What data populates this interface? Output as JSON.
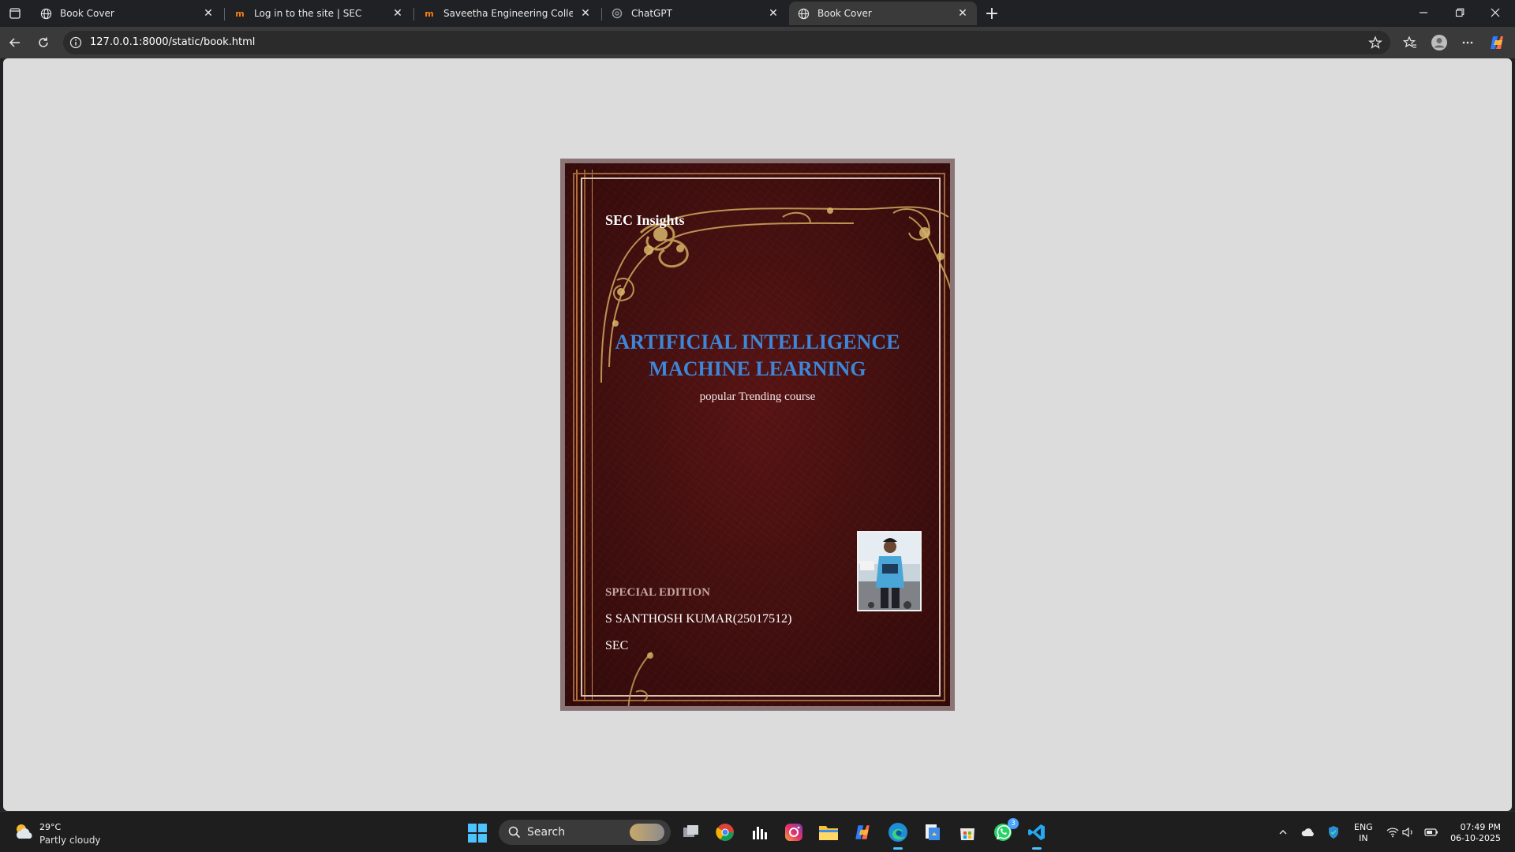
{
  "browser": {
    "tabs": [
      {
        "title": "Book Cover",
        "icon": "globe-icon"
      },
      {
        "title": "Log in to the site | SEC",
        "icon": "moodle-icon"
      },
      {
        "title": "Saveetha Engineering College: Lo",
        "icon": "moodle-icon"
      },
      {
        "title": "ChatGPT",
        "icon": "chatgpt-icon"
      },
      {
        "title": "Book Cover",
        "icon": "globe-icon",
        "active": true
      }
    ],
    "url": "127.0.0.1:8000/static/book.html"
  },
  "book": {
    "brand": "SEC Insights",
    "title_line1": "ARTIFICIAL INTELLIGENCE",
    "title_line2": "MACHINE LEARNING",
    "subtitle": "popular Trending course",
    "edition": "SPECIAL EDITION",
    "author": "S SANTHOSH KUMAR(25017512)",
    "org": "SEC",
    "title_color": "#3d86d8",
    "cover_color": "#461010"
  },
  "taskbar": {
    "weather_temp": "29°C",
    "weather_desc": "Partly cloudy",
    "search_label": "Search",
    "whatsapp_badge": "3",
    "lang_line1": "ENG",
    "lang_line2": "IN",
    "time": "07:49 PM",
    "date": "06-10-2025"
  }
}
